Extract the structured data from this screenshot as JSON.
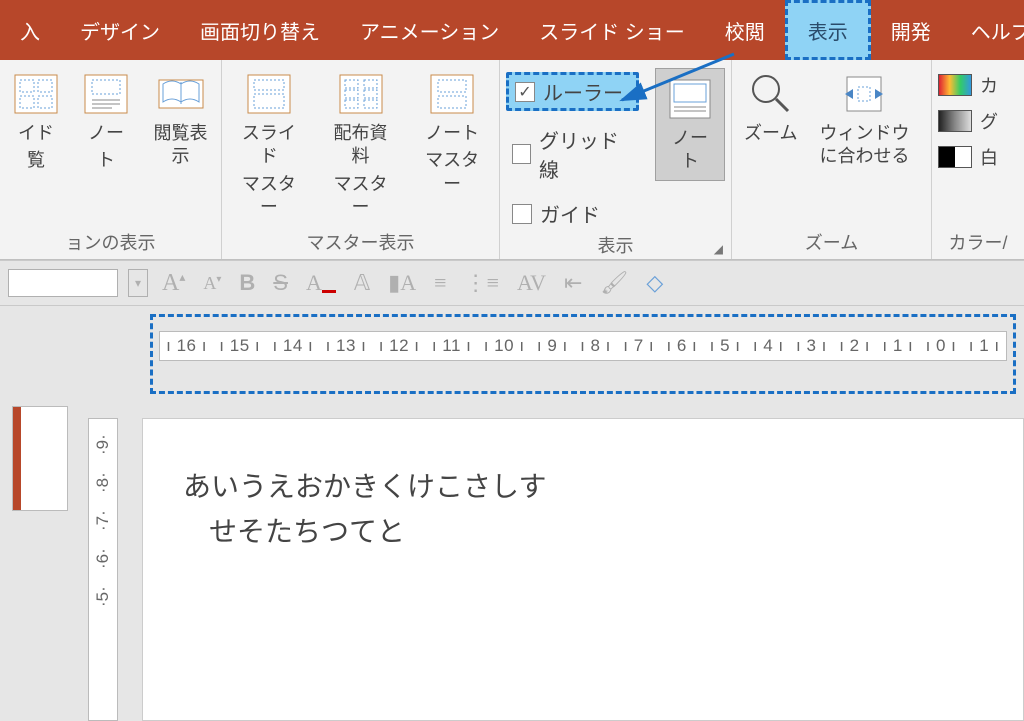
{
  "tabs": {
    "items": [
      "入",
      "デザイン",
      "画面切り替え",
      "アニメーション",
      "スライド ショー",
      "校閲",
      "表示",
      "開発",
      "ヘルプ"
    ],
    "active_index": 6
  },
  "groups": {
    "presViews": {
      "label": "ョンの表示",
      "btns": [
        {
          "l1": "イド",
          "l2": "覧"
        },
        {
          "l1": "ノー",
          "l2": "ト"
        },
        {
          "l1": "閲覧表示",
          "l2": ""
        }
      ]
    },
    "master": {
      "label": "マスター表示",
      "btns": [
        {
          "l1": "スライド",
          "l2": "マスター"
        },
        {
          "l1": "配布資料",
          "l2": "マスター"
        },
        {
          "l1": "ノート",
          "l2": "マスター"
        }
      ]
    },
    "show": {
      "label": "表示",
      "ruler": "ルーラー",
      "grid": "グリッド線",
      "guide": "ガイド",
      "notes": "ノー\nト"
    },
    "zoom": {
      "label": "ズーム",
      "zoom": "ズーム",
      "fit": "ウィンドウ\nに合わせる"
    },
    "color": {
      "label": "カラー/",
      "color": "カ",
      "gray": "グ",
      "bw": "白"
    }
  },
  "ruler_numbers": [
    "16",
    "15",
    "14",
    "13",
    "12",
    "11",
    "10",
    "9",
    "8",
    "7",
    "6",
    "5",
    "4",
    "3",
    "2",
    "1",
    "0",
    "1"
  ],
  "vruler_numbers": [
    "9",
    "8",
    "7",
    "6",
    "5"
  ],
  "slide": {
    "line1": "あいうえおかきくけこさしす",
    "line2": "せそたちつてと"
  }
}
